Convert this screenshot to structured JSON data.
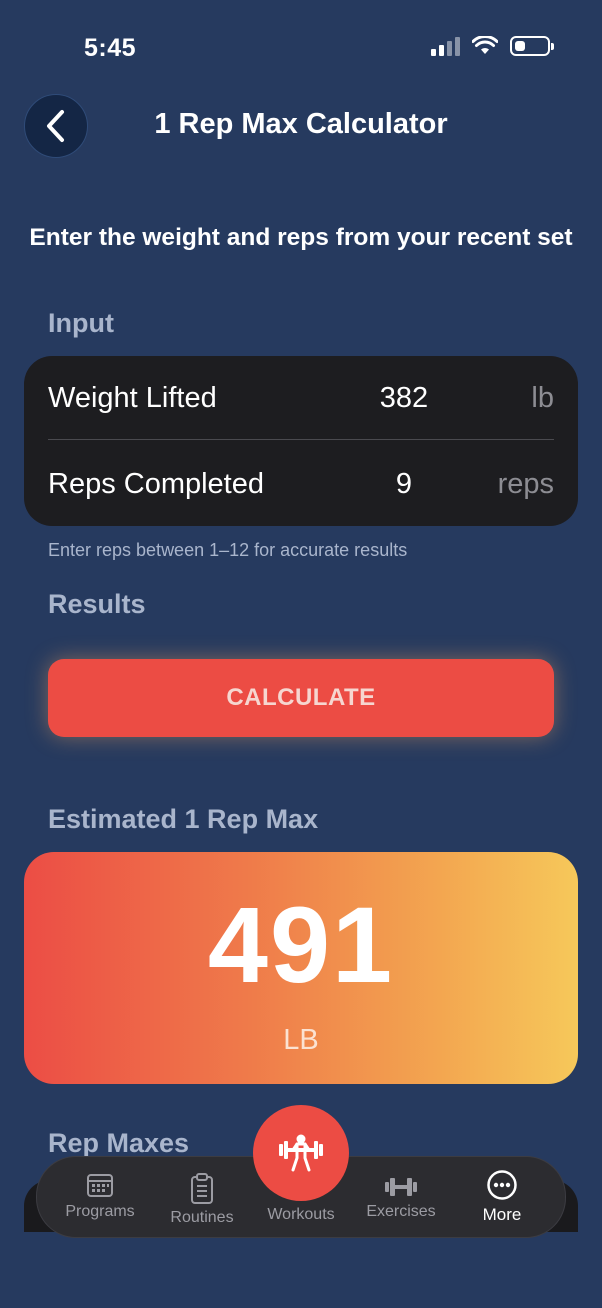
{
  "status_bar": {
    "time": "5:45"
  },
  "header": {
    "title": "1 Rep Max Calculator"
  },
  "instruction": "Enter the weight and reps from your recent set",
  "input": {
    "section_label": "Input",
    "rows": [
      {
        "label": "Weight Lifted",
        "value": "382",
        "unit": "lb"
      },
      {
        "label": "Reps Completed",
        "value": "9",
        "unit": "reps"
      }
    ],
    "hint": "Enter reps between 1–12 for accurate results"
  },
  "results": {
    "section_label": "Results",
    "calculate_label": "CALCULATE"
  },
  "estimate": {
    "section_label": "Estimated 1 Rep Max",
    "value": "491",
    "unit": "LB"
  },
  "rep_maxes": {
    "section_label": "Rep Maxes"
  },
  "tab_bar": {
    "items": [
      {
        "label": "Programs",
        "icon": "calendar-icon"
      },
      {
        "label": "Routines",
        "icon": "clipboard-icon"
      },
      {
        "label": "Workouts",
        "icon": "weightlifter-icon"
      },
      {
        "label": "Exercises",
        "icon": "dumbbell-icon"
      },
      {
        "label": "More",
        "icon": "more-icon"
      }
    ],
    "active": "More"
  },
  "colors": {
    "background": "#263a5f",
    "card": "#1d1d20",
    "accent": "#ec4c44",
    "gradient_start": "#ec4d45",
    "gradient_end": "#f6c85a"
  }
}
